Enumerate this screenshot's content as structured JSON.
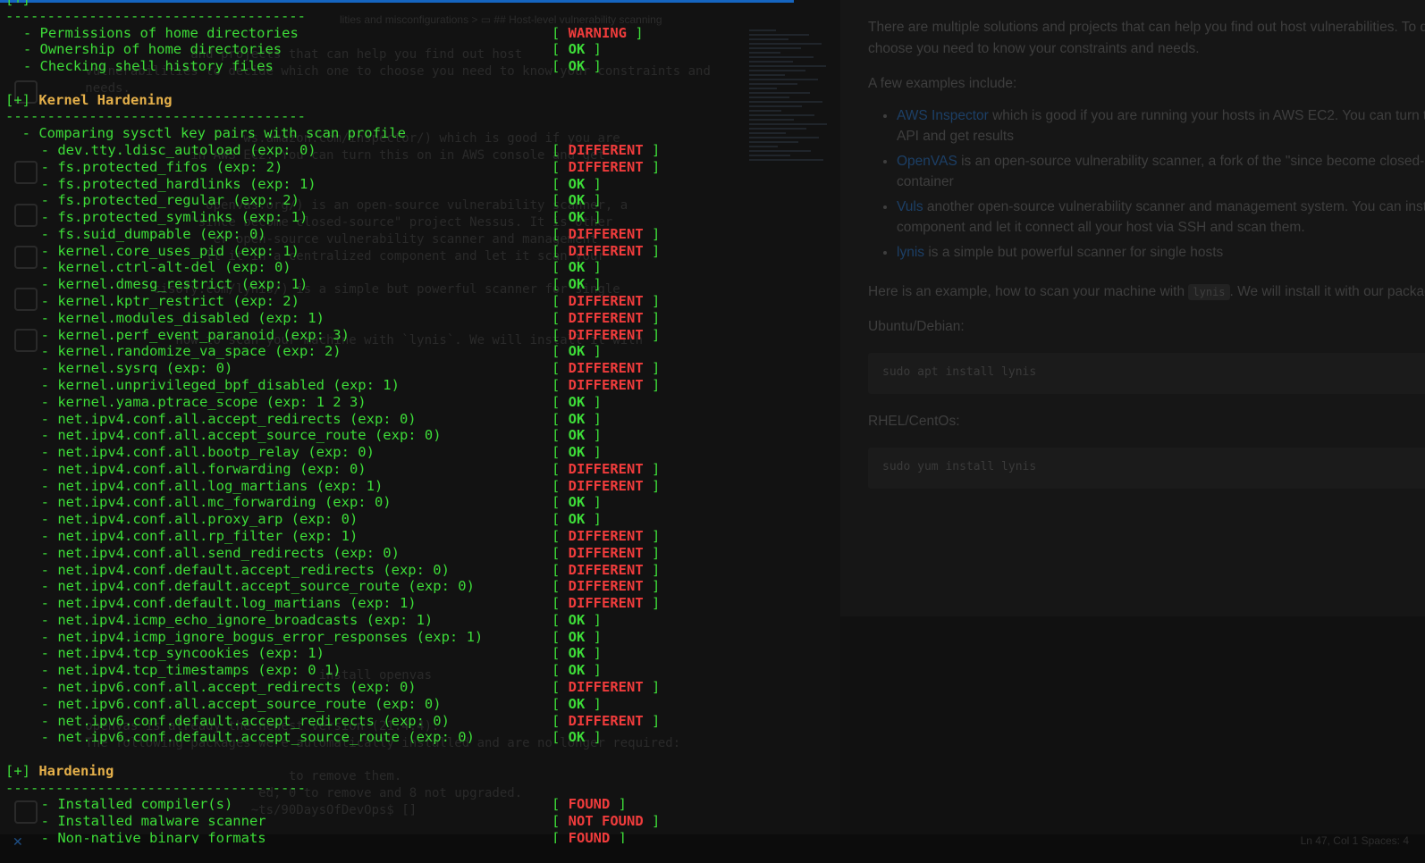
{
  "editor_bg": {
    "breadcrumb": "lities and misconfigurations > ▭ ## Host-level vulnerability scanning",
    "lines": [
      "                 and projects that can help you find out host",
      "   vulnerabilities to decide which one to choose you need to know your constraints and",
      "   needs.",
      "",
      "",
      "                        ws.amazon.com/inspector/) which is good if you are",
      "                 in AWS EC2. You can turn this on in AWS console and get",
      "",
      "",
      "                   openvas.org/) is an open-source vulnerability scanner, a",
      "                 \"since become closed-source\" project Nessus. It is other",
      "                    er open-source vulnerability scanner and management",
      "                   ll it in a centralized component and let it scan your",
      "",
      "            cisofy.com/lynis/) is a simple but powerful scanner for single",
      "",
      "",
      "               how to scan your machine with `lynis`. We will install it with",
      "",
      "",
      "",
      "",
      "",
      "",
      "",
      "",
      "",
      "",
      "",
      "",
      "",
      "",
      "",
      "",
      "",
      "",
      "",
      "                                  install openvas",
      "",
      "",
      "   openvas is already the newest version (21.4.4).",
      "   The following packages were automatically installed and are no longer required:",
      "",
      "                              to remove them.",
      "                          ed, 0 to remove and 8 not upgraded.",
      "                         ~ts/90DaysOfDevOps$ []"
    ]
  },
  "preview": {
    "intro_line1": "There are multiple solutions and projects that can help you find out host vulnerabilities. To decide which one to",
    "intro_line2": "choose you need to know your constraints and needs.",
    "few_examples": "A few examples include:",
    "items": [
      {
        "link": "AWS Inspector",
        "text1": " which is good if you are running your hosts in AWS EC2. You can turn this on in AWS console and",
        "text2": "API and get results"
      },
      {
        "link": "OpenVAS",
        "text1": " is an open-source vulnerability scanner, a fork of the \"since become closed-source\" project Nessus.",
        "text2": "container"
      },
      {
        "link": "Vuls",
        "text1": " another open-source vulnerability scanner and management system. You can install it in a centralized",
        "text2": "component and let it connect all your host via SSH and scan them."
      },
      {
        "link": "lynis",
        "text1": " is a simple but powerful scanner for single hosts",
        "text2": ""
      }
    ],
    "example_prefix": "Here is an example, how to scan your machine with ",
    "example_code": "lynis",
    "example_suffix": ". We will install it with our package manager.",
    "ubuntu_label": "Ubuntu/Debian:",
    "ubuntu_cmd": "sudo apt install lynis",
    "rhel_label": "RHEL/CentOs:",
    "rhel_cmd": "sudo yum install lynis"
  },
  "status_bar": {
    "left": "✕",
    "right": "Ln 47, Col 1    Spaces: 4"
  },
  "terminal": {
    "top_fragment": "[+]",
    "separator": "------------------------------------",
    "home_items": [
      {
        "name": "- Permissions of home directories",
        "status": "WARNING"
      },
      {
        "name": "- Ownership of home directories",
        "status": "OK"
      },
      {
        "name": "- Checking shell history files",
        "status": "OK"
      }
    ],
    "kernel_section": {
      "prefix": "[+]",
      "title": "Kernel Hardening"
    },
    "compare_line": "- Comparing sysctl key pairs with scan profile",
    "sysctl_items": [
      {
        "name": "- dev.tty.ldisc_autoload (exp: 0)",
        "status": "DIFFERENT"
      },
      {
        "name": "- fs.protected_fifos (exp: 2)",
        "status": "DIFFERENT"
      },
      {
        "name": "- fs.protected_hardlinks (exp: 1)",
        "status": "OK"
      },
      {
        "name": "- fs.protected_regular (exp: 2)",
        "status": "OK"
      },
      {
        "name": "- fs.protected_symlinks (exp: 1)",
        "status": "OK"
      },
      {
        "name": "- fs.suid_dumpable (exp: 0)",
        "status": "DIFFERENT"
      },
      {
        "name": "- kernel.core_uses_pid (exp: 1)",
        "status": "DIFFERENT"
      },
      {
        "name": "- kernel.ctrl-alt-del (exp: 0)",
        "status": "OK"
      },
      {
        "name": "- kernel.dmesg_restrict (exp: 1)",
        "status": "OK"
      },
      {
        "name": "- kernel.kptr_restrict (exp: 2)",
        "status": "DIFFERENT"
      },
      {
        "name": "- kernel.modules_disabled (exp: 1)",
        "status": "DIFFERENT"
      },
      {
        "name": "- kernel.perf_event_paranoid (exp: 3)",
        "status": "DIFFERENT"
      },
      {
        "name": "- kernel.randomize_va_space (exp: 2)",
        "status": "OK"
      },
      {
        "name": "- kernel.sysrq (exp: 0)",
        "status": "DIFFERENT"
      },
      {
        "name": "- kernel.unprivileged_bpf_disabled (exp: 1)",
        "status": "DIFFERENT"
      },
      {
        "name": "- kernel.yama.ptrace_scope (exp: 1 2 3)",
        "status": "OK"
      },
      {
        "name": "- net.ipv4.conf.all.accept_redirects (exp: 0)",
        "status": "OK"
      },
      {
        "name": "- net.ipv4.conf.all.accept_source_route (exp: 0)",
        "status": "OK"
      },
      {
        "name": "- net.ipv4.conf.all.bootp_relay (exp: 0)",
        "status": "OK"
      },
      {
        "name": "- net.ipv4.conf.all.forwarding (exp: 0)",
        "status": "DIFFERENT"
      },
      {
        "name": "- net.ipv4.conf.all.log_martians (exp: 1)",
        "status": "DIFFERENT"
      },
      {
        "name": "- net.ipv4.conf.all.mc_forwarding (exp: 0)",
        "status": "OK"
      },
      {
        "name": "- net.ipv4.conf.all.proxy_arp (exp: 0)",
        "status": "OK"
      },
      {
        "name": "- net.ipv4.conf.all.rp_filter (exp: 1)",
        "status": "DIFFERENT"
      },
      {
        "name": "- net.ipv4.conf.all.send_redirects (exp: 0)",
        "status": "DIFFERENT"
      },
      {
        "name": "- net.ipv4.conf.default.accept_redirects (exp: 0)",
        "status": "DIFFERENT"
      },
      {
        "name": "- net.ipv4.conf.default.accept_source_route (exp: 0)",
        "status": "DIFFERENT"
      },
      {
        "name": "- net.ipv4.conf.default.log_martians (exp: 1)",
        "status": "DIFFERENT"
      },
      {
        "name": "- net.ipv4.icmp_echo_ignore_broadcasts (exp: 1)",
        "status": "OK"
      },
      {
        "name": "- net.ipv4.icmp_ignore_bogus_error_responses (exp: 1)",
        "status": "OK"
      },
      {
        "name": "- net.ipv4.tcp_syncookies (exp: 1)",
        "status": "OK"
      },
      {
        "name": "- net.ipv4.tcp_timestamps (exp: 0 1)",
        "status": "OK"
      },
      {
        "name": "- net.ipv6.conf.all.accept_redirects (exp: 0)",
        "status": "DIFFERENT"
      },
      {
        "name": "- net.ipv6.conf.all.accept_source_route (exp: 0)",
        "status": "OK"
      },
      {
        "name": "- net.ipv6.conf.default.accept_redirects (exp: 0)",
        "status": "DIFFERENT"
      },
      {
        "name": "- net.ipv6.conf.default.accept_source_route (exp: 0)",
        "status": "OK"
      }
    ],
    "hardening_section": {
      "prefix": "[+]",
      "title": "Hardening"
    },
    "hardening_items": [
      {
        "name": "- Installed compiler(s)",
        "status": "FOUND"
      },
      {
        "name": "- Installed malware scanner",
        "status": "NOT FOUND"
      },
      {
        "name": "- Non-native binary formats",
        "status": "FOUND"
      }
    ],
    "colors": {
      "green": "#3ddc38",
      "red": "#f03c3c",
      "orange": "#e5b04a"
    }
  }
}
